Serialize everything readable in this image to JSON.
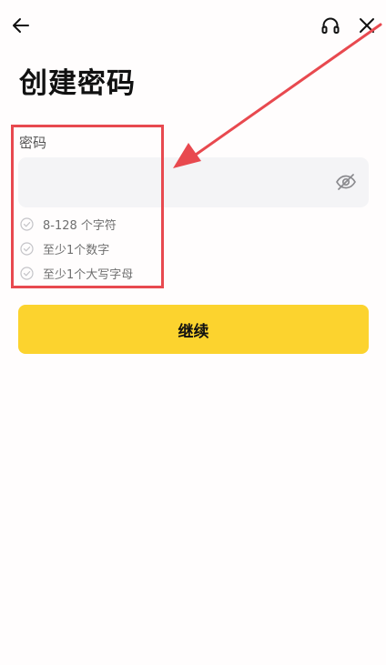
{
  "header": {
    "back_icon": "arrow-left-icon",
    "support_icon": "headset-icon",
    "close_icon": "close-icon"
  },
  "page": {
    "title": "创建密码"
  },
  "password_field": {
    "label": "密码",
    "value": "",
    "placeholder": "",
    "visibility_icon": "eye-slash-icon"
  },
  "requirements": [
    {
      "label": "8-128 个字符",
      "met": false
    },
    {
      "label": "至少1个数字",
      "met": false
    },
    {
      "label": "至少1个大写字母",
      "met": false
    }
  ],
  "actions": {
    "continue_label": "继续"
  },
  "colors": {
    "accent": "#fcd32e",
    "annotation": "#e8494f",
    "input_bg": "#f4f4f6",
    "muted_text": "#6f6f6f"
  }
}
